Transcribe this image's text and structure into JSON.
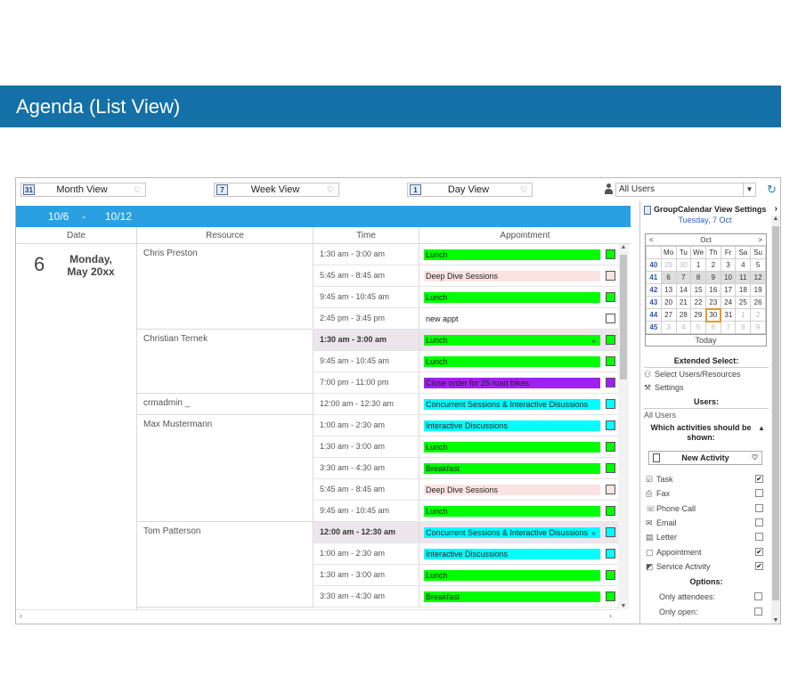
{
  "banner": {
    "title": "Agenda (List View)"
  },
  "toolbar": {
    "month_icon": "31",
    "month_label": "Month View",
    "week_icon": "7",
    "week_label": "Week View",
    "day_icon": "1",
    "day_label": "Day View",
    "users_value": "All Users"
  },
  "datebar": {
    "start": "10/6",
    "sep": "-",
    "end": "10/12"
  },
  "columns": {
    "date": "Date",
    "resource": "Resource",
    "time": "Time",
    "appointment": "Appointment"
  },
  "day": {
    "number": "6",
    "name": "Monday,",
    "date": "May 20xx"
  },
  "resources": [
    {
      "name": "Chris Preston",
      "rows": [
        {
          "time": "1:30 am - 3:00 am",
          "appt": "Lunch",
          "color": "#00ff00"
        },
        {
          "time": "5:45 am - 8:45 am",
          "appt": "Deep Dive Sessions",
          "color": "#fbe3e3"
        },
        {
          "time": "9:45 am - 10:45 am",
          "appt": "Lunch",
          "color": "#00ff00"
        },
        {
          "time": "2:45 pm - 3:45 pm",
          "appt": "new appt",
          "color": "transparent"
        }
      ]
    },
    {
      "name": "Christian Ternek",
      "rows": [
        {
          "time": "1:30 am - 3:00 am",
          "appt": "Lunch",
          "color": "#00ff00",
          "highlight": true,
          "close": "×"
        },
        {
          "time": "9:45 am - 10:45 am",
          "appt": "Lunch",
          "color": "#00ff00"
        },
        {
          "time": "7:00 pm - 11:00 pm",
          "appt": "Close order for 25 road bikes",
          "color": "#a020f0"
        }
      ]
    },
    {
      "name": "crmadmin _",
      "rows": [
        {
          "time": "12:00 am - 12:30 am",
          "appt": "Concurrent Sessions & Interactive Disussions",
          "color": "#00ffff"
        }
      ]
    },
    {
      "name": "Max Mustermann",
      "rows": [
        {
          "time": "1:00 am - 2:30 am",
          "appt": "Interactive Discussions",
          "color": "#00ffff"
        },
        {
          "time": "1:30 am - 3:00 am",
          "appt": "Lunch",
          "color": "#00ff00"
        },
        {
          "time": "3:30 am - 4:30 am",
          "appt": "Breakfast",
          "color": "#00ff00"
        },
        {
          "time": "5:45 am - 8:45 am",
          "appt": "Deep Dive Sessions",
          "color": "#fbe3e3"
        },
        {
          "time": "9:45 am - 10:45 am",
          "appt": "Lunch",
          "color": "#00ff00"
        }
      ]
    },
    {
      "name": "Tom Patterson",
      "rows": [
        {
          "time": "12:00 am - 12:30 am",
          "appt": "Concurrent Sessions & Interactive Disussions",
          "color": "#00ffff",
          "highlight": true,
          "close": "×"
        },
        {
          "time": "1:00 am - 2:30 am",
          "appt": "Interactive Discussions",
          "color": "#00ffff"
        },
        {
          "time": "1:30 am - 3:00 am",
          "appt": "Lunch",
          "color": "#00ff00"
        },
        {
          "time": "3:30 am - 4:30 am",
          "appt": "Breakfast",
          "color": "#00ff00"
        }
      ]
    }
  ],
  "panel": {
    "title": "GroupCalendar View Settings",
    "current_date": "Tuesday, 7 Oct",
    "calendar": {
      "month": "Oct",
      "prev": "<",
      "next": ">",
      "weekdays": [
        "Mo",
        "Tu",
        "We",
        "Th",
        "Fr",
        "Sa",
        "Su"
      ],
      "weeks": [
        {
          "wk": "40",
          "days": [
            "29",
            "30",
            "1",
            "2",
            "3",
            "4",
            "5"
          ],
          "other": [
            0,
            1
          ]
        },
        {
          "wk": "41",
          "days": [
            "6",
            "7",
            "8",
            "9",
            "10",
            "11",
            "12"
          ],
          "selected": true
        },
        {
          "wk": "42",
          "days": [
            "13",
            "14",
            "15",
            "16",
            "17",
            "18",
            "19"
          ]
        },
        {
          "wk": "43",
          "days": [
            "20",
            "21",
            "22",
            "23",
            "24",
            "25",
            "26"
          ]
        },
        {
          "wk": "44",
          "days": [
            "27",
            "28",
            "29",
            "30",
            "31",
            "1",
            "2"
          ],
          "other": [
            5,
            6
          ],
          "today": 3
        },
        {
          "wk": "45",
          "days": [
            "3",
            "4",
            "5",
            "6",
            "7",
            "8",
            "9"
          ],
          "other": [
            0,
            1,
            2,
            3,
            4,
            5,
            6
          ]
        }
      ],
      "today_label": "Today"
    },
    "extended_select": "Extended Select:",
    "select_users": "Select Users/Resources",
    "settings": "Settings",
    "users_heading": "Users:",
    "all_users": "All Users",
    "which_activities": "Which activities should be shown:",
    "new_activity": "New Activity",
    "activities": [
      {
        "label": "Task",
        "icon": "☑",
        "checked": true
      },
      {
        "label": "Fax",
        "icon": "⎙",
        "checked": false
      },
      {
        "label": "Phone Call",
        "icon": "☏",
        "checked": false
      },
      {
        "label": "Email",
        "icon": "✉",
        "checked": false
      },
      {
        "label": "Letter",
        "icon": "▤",
        "checked": false
      },
      {
        "label": "Appointment",
        "icon": "▢",
        "checked": true
      },
      {
        "label": "Service Activity",
        "icon": "◩",
        "checked": true
      }
    ],
    "options_heading": "Options:",
    "options": [
      "Only attendees:",
      "Only open:"
    ]
  }
}
